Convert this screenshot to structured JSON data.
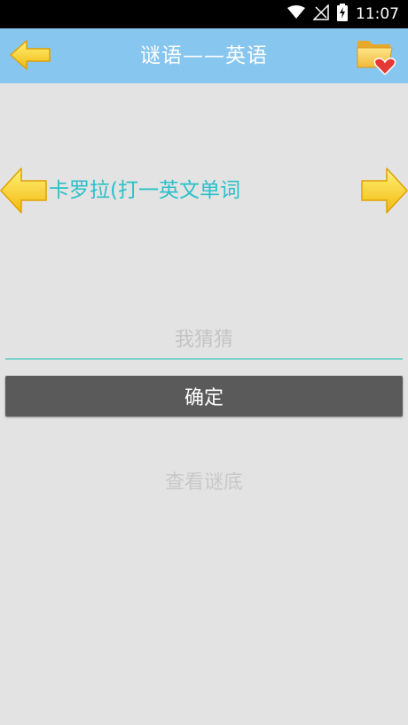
{
  "status_bar": {
    "time": "11:07",
    "icons": [
      "wifi-icon",
      "signal-icon",
      "battery-charging-icon"
    ]
  },
  "header": {
    "title": "谜语——英语",
    "back_icon": "arrow-left-icon",
    "favorite_icon": "folder-heart-icon"
  },
  "riddle": {
    "text": "卡罗拉(打一英文单词",
    "prev_icon": "arrow-left-icon",
    "next_icon": "arrow-right-icon"
  },
  "answer": {
    "value": "",
    "placeholder": "我猜猜"
  },
  "confirm_label": "确定",
  "reveal_label": "查看谜底",
  "colors": {
    "header": "#87c6ef",
    "riddle_text": "#2bc0c8",
    "button": "#5a5a5a",
    "arrow": "#f7d21e"
  }
}
